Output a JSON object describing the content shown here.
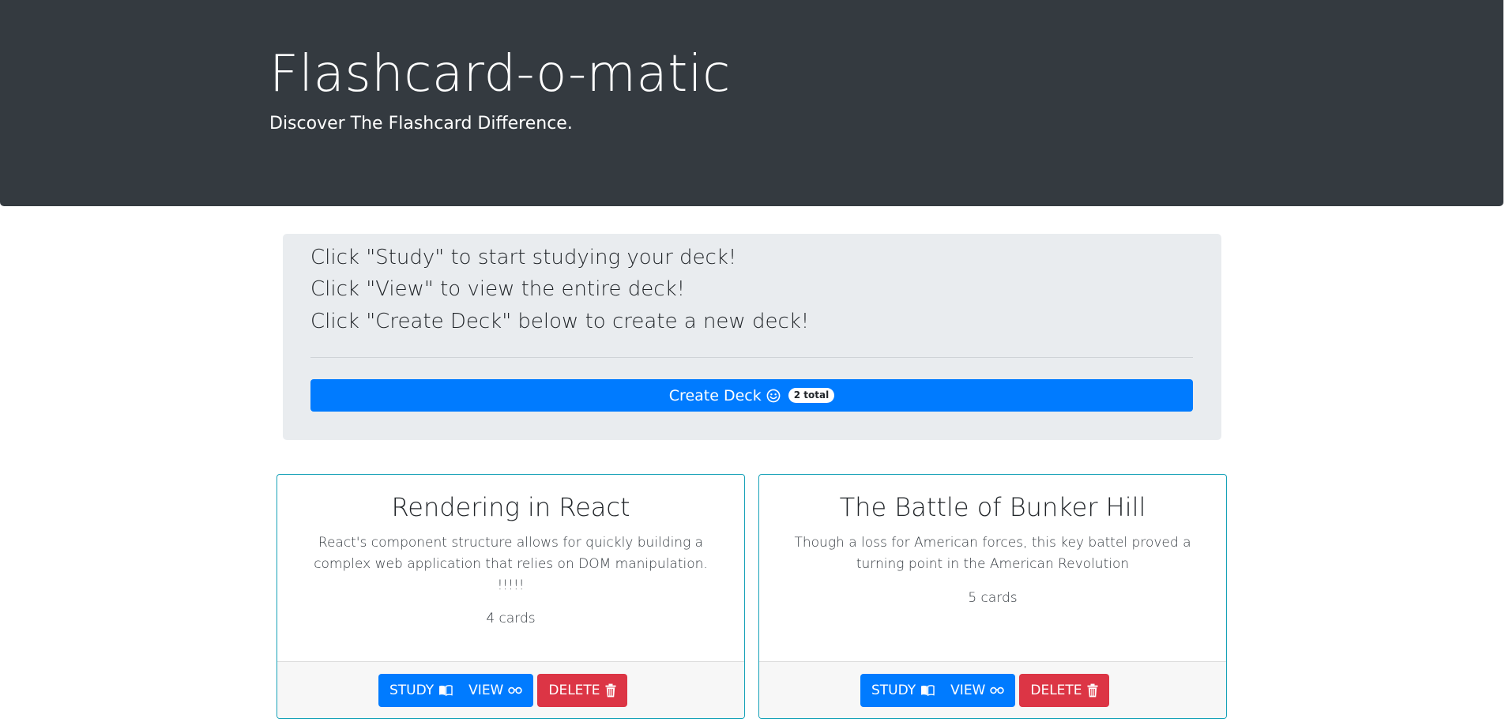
{
  "header": {
    "title": "Flashcard-o-matic",
    "subtitle": "Discover The Flashcard Difference."
  },
  "info": {
    "lines": [
      "Click \"Study\" to start studying your deck!",
      "Click \"View\" to view the entire deck!",
      "Click \"Create Deck\" below to create a new deck!"
    ],
    "create_button_label": "Create Deck",
    "create_button_icon": "smile-icon",
    "deck_total_badge": "2 total"
  },
  "decks": [
    {
      "title": "Rendering in React",
      "description": "React's component structure allows for quickly building a complex web application that relies on DOM manipulation. !!!!!",
      "card_count": "4 cards",
      "study_label": "STUDY",
      "view_label": "VIEW",
      "delete_label": "DELETE"
    },
    {
      "title": "The Battle of Bunker Hill",
      "description": "Though a loss for American forces, this key battel proved a turning point in the American Revolution",
      "card_count": "5 cards",
      "study_label": "STUDY",
      "view_label": "VIEW",
      "delete_label": "DELETE"
    }
  ],
  "colors": {
    "header_bg": "#343a40",
    "panel_bg": "#e9ecef",
    "primary": "#007bff",
    "danger": "#dc3545",
    "card_border": "#17a2b8"
  }
}
